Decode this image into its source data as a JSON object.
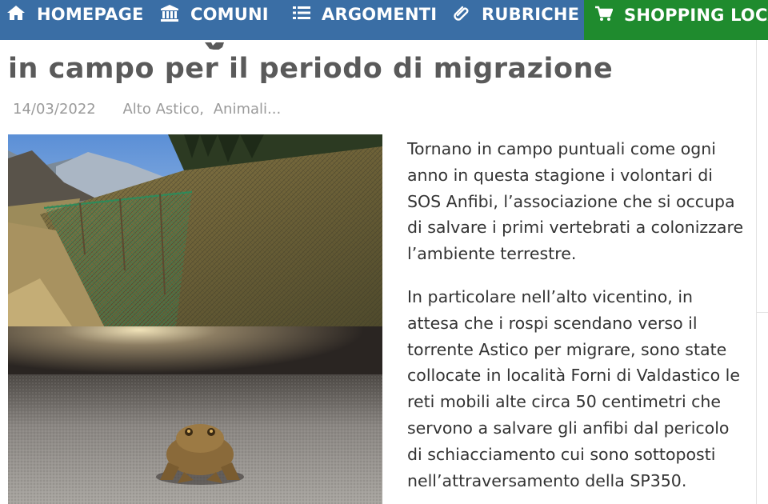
{
  "nav": {
    "items": [
      {
        "label": "HOMEPAGE",
        "icon": "home-icon"
      },
      {
        "label": "COMUNI",
        "icon": "institution-icon"
      },
      {
        "label": "ARGOMENTI",
        "icon": "list-icon"
      },
      {
        "label": "RUBRICHE",
        "icon": "paperclip-icon"
      },
      {
        "label": "SHOPPING LOCALE",
        "icon": "cart-icon"
      }
    ],
    "colors": {
      "bar": "#3a6ea5",
      "shop": "#1f8b2e"
    }
  },
  "article": {
    "title": "in campo per il periodo di migrazione",
    "date": "14/03/2022",
    "categories": [
      "Alto Astico,",
      "Animali..."
    ],
    "paragraphs": [
      "Tornano in campo puntuali come ogni anno in questa stagione i volontari di SOS Anfibi, l’associazione che si occupa di salvare i primi vertebrati a colonizzare l’ambiente terrestre.",
      "In particolare nell’alto vicentino, in attesa che i rospi scendano verso il torrente Astico per migrare, sono state collocate in località Forni di Valdastico le reti mobili alte circa 50 centimetri che servono a salvare gli anfibi dal pericolo di schiacciamento cui sono sottoposti nell’attraversamento della SP350."
    ]
  }
}
